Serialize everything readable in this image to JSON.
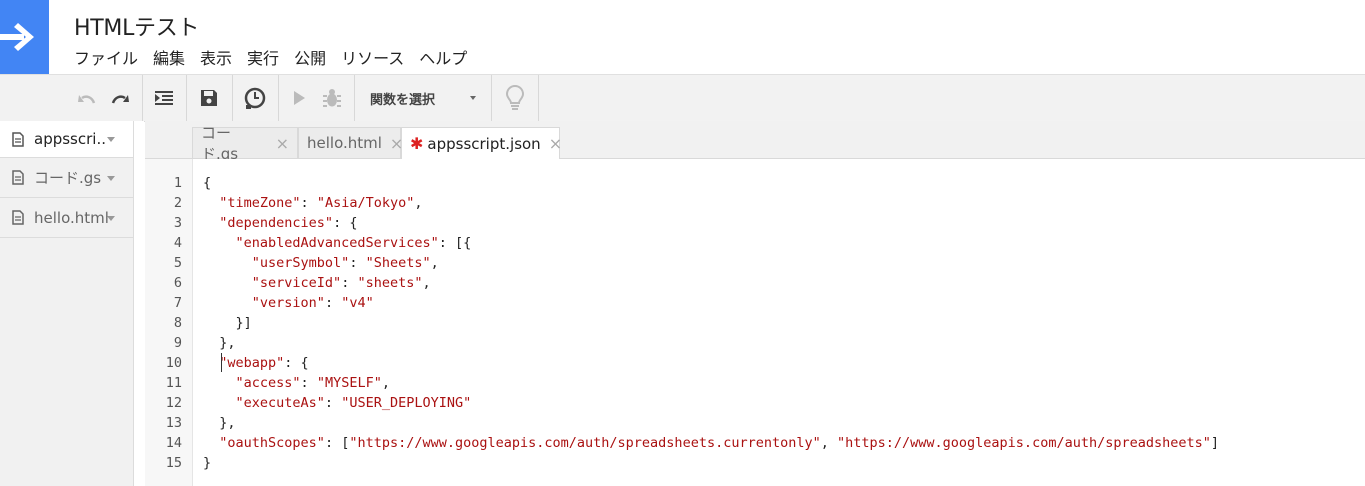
{
  "app": {
    "title": "HTMLテスト",
    "menu": [
      "ファイル",
      "編集",
      "表示",
      "実行",
      "公開",
      "リソース",
      "ヘルプ"
    ]
  },
  "toolbar": {
    "function_select": "関数を選択",
    "icons": [
      "undo-icon",
      "redo-icon",
      "indent-icon",
      "save-icon",
      "triggers-icon",
      "run-icon",
      "debug-icon",
      "lightbulb-icon"
    ]
  },
  "sidebar": {
    "files": [
      {
        "label": "appsscri..",
        "active": true
      },
      {
        "label": "コード.gs",
        "active": false
      },
      {
        "label": "hello.html",
        "active": false
      }
    ]
  },
  "tabs": [
    {
      "label": "コード.gs",
      "active": false,
      "modified": false
    },
    {
      "label": "hello.html",
      "active": false,
      "modified": false
    },
    {
      "label": "appsscript.json",
      "active": true,
      "modified": true
    }
  ],
  "editor": {
    "line_numbers": [
      "1",
      "2",
      "3",
      "4",
      "5",
      "6",
      "7",
      "8",
      "9",
      "10",
      "11",
      "12",
      "13",
      "14",
      "15"
    ],
    "lines": [
      "{",
      "  \"timeZone\": \"Asia/Tokyo\",",
      "  \"dependencies\": {",
      "    \"enabledAdvancedServices\": [{",
      "      \"userSymbol\": \"Sheets\",",
      "      \"serviceId\": \"sheets\",",
      "      \"version\": \"v4\"",
      "    }]",
      "  },",
      "  \"webapp\": {",
      "    \"access\": \"MYSELF\",",
      "    \"executeAs\": \"USER_DEPLOYING\"",
      "  },",
      "  \"oauthScopes\": [\"https://www.googleapis.com/auth/spreadsheets.currentonly\", \"https://www.googleapis.com/auth/spreadsheets\"]",
      "}"
    ]
  },
  "colors": {
    "logo_blue": "#4285f4",
    "string_red": "#aa1111",
    "modified_star": "#dd2222"
  }
}
